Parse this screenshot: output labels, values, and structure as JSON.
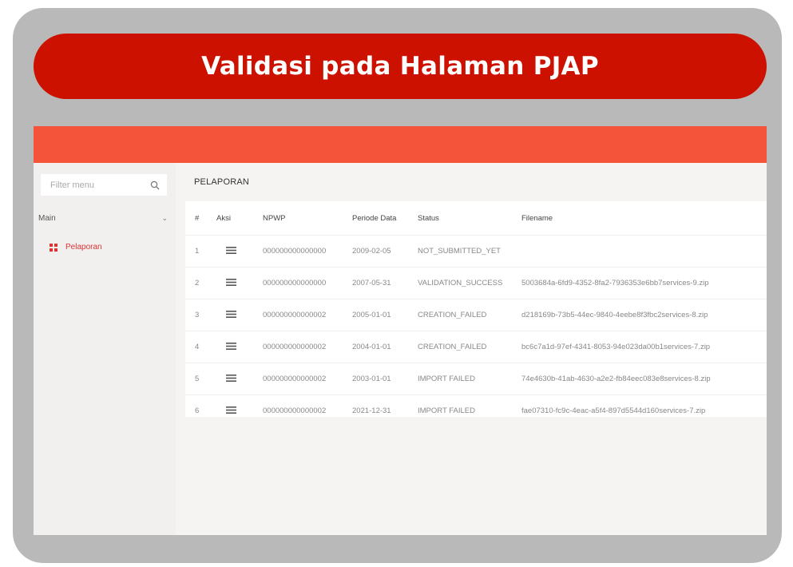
{
  "banner": {
    "title": "Validasi pada Halaman PJAP"
  },
  "sidebar": {
    "filter_placeholder": "Filter menu",
    "section_label": "Main",
    "items": [
      {
        "label": "Pelaporan",
        "icon": "grid-icon"
      }
    ]
  },
  "main": {
    "title": "PELAPORAN",
    "columns": [
      "#",
      "Aksi",
      "NPWP",
      "Periode Data",
      "Status",
      "Filename"
    ],
    "rows": [
      {
        "num": "1",
        "npwp": "000000000000000",
        "periode": "2009-02-05",
        "status": "NOT_SUBMITTED_YET",
        "filename": ""
      },
      {
        "num": "2",
        "npwp": "000000000000000",
        "periode": "2007-05-31",
        "status": "VALIDATION_SUCCESS",
        "filename": "5003684a-6fd9-4352-8fa2-7936353e6bb7services-9.zip"
      },
      {
        "num": "3",
        "npwp": "000000000000002",
        "periode": "2005-01-01",
        "status": "CREATION_FAILED",
        "filename": "d218169b-73b5-44ec-9840-4eebe8f3fbc2services-8.zip"
      },
      {
        "num": "4",
        "npwp": "000000000000002",
        "periode": "2004-01-01",
        "status": "CREATION_FAILED",
        "filename": "bc6c7a1d-97ef-4341-8053-94e023da00b1services-7.zip"
      },
      {
        "num": "5",
        "npwp": "000000000000002",
        "periode": "2003-01-01",
        "status": "IMPORT FAILED",
        "filename": "74e4630b-41ab-4630-a2e2-fb84eec083e8services-8.zip"
      },
      {
        "num": "6",
        "npwp": "000000000000002",
        "periode": "2021-12-31",
        "status": "IMPORT FAILED",
        "filename": "fae07310-fc9c-4eac-a5f4-897d5544d160services-7.zip"
      }
    ]
  },
  "colors": {
    "banner": "#cc1100",
    "topbar": "#f4553a",
    "accent": "#dd3333",
    "frame": "#b9b9b9",
    "background": "#f6f4f2"
  }
}
